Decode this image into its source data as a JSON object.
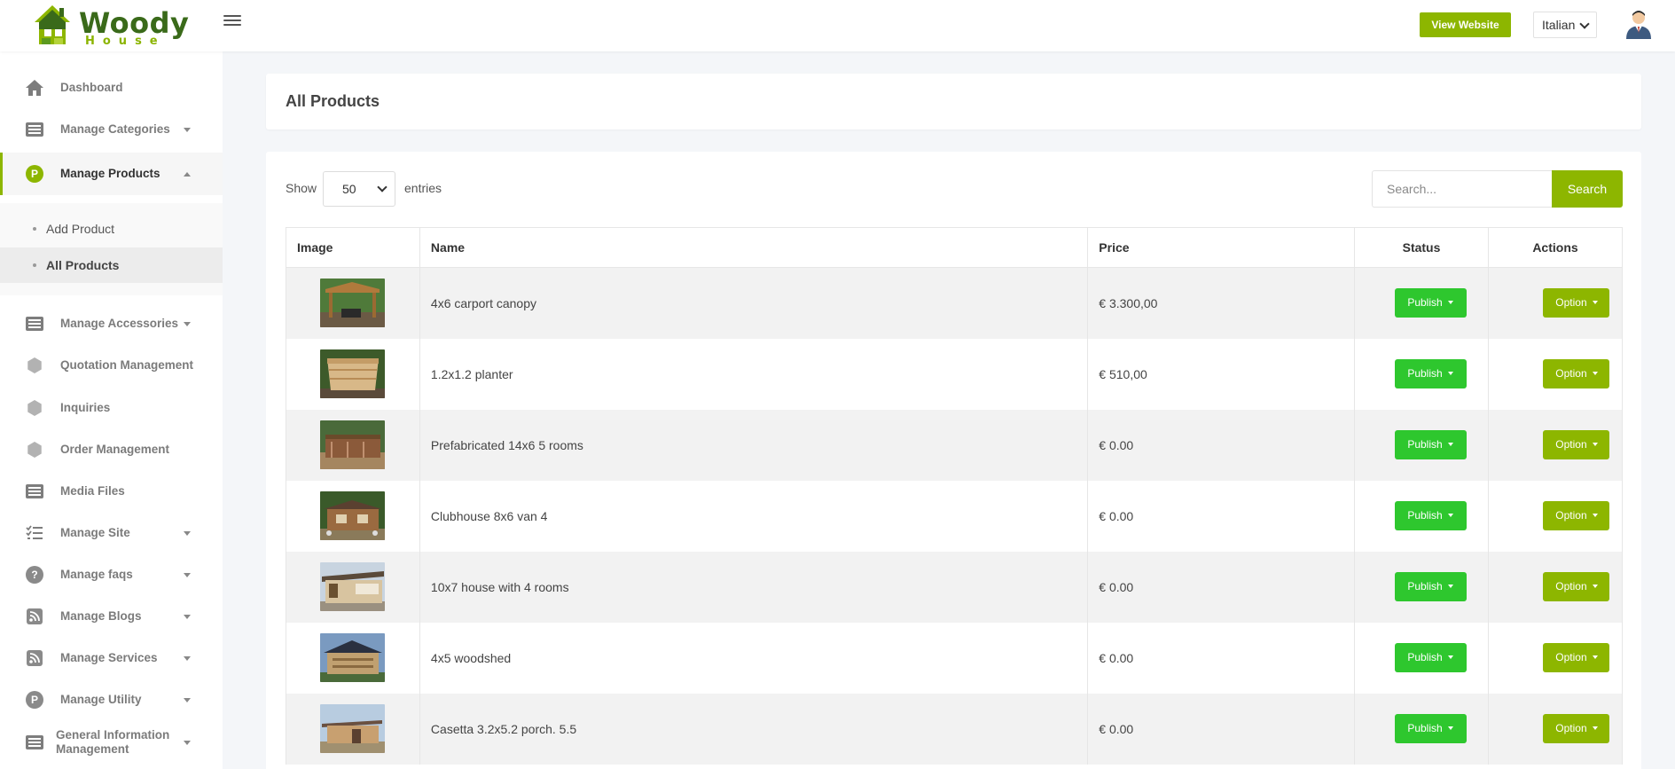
{
  "header": {
    "brand_line1": "Woody",
    "brand_line2": "House",
    "view_website": "View Website",
    "language": "Italian"
  },
  "sidebar": {
    "items": [
      {
        "label": "Dashboard",
        "icon": "home-icon"
      },
      {
        "label": "Manage Categories",
        "icon": "list-icon"
      },
      {
        "label": "Manage Products",
        "icon": "products-icon"
      },
      {
        "label": "Manage Accessories",
        "icon": "list-icon"
      },
      {
        "label": "Quotation Management",
        "icon": "hexagon-icon"
      },
      {
        "label": "Inquiries",
        "icon": "hexagon-icon"
      },
      {
        "label": "Order Management",
        "icon": "hexagon-icon"
      },
      {
        "label": "Media Files",
        "icon": "list-icon"
      },
      {
        "label": "Manage Site",
        "icon": "checklist-icon"
      },
      {
        "label": "Manage faqs",
        "icon": "question-icon"
      },
      {
        "label": "Manage Blogs",
        "icon": "rss-icon"
      },
      {
        "label": "Manage Services",
        "icon": "rss-icon"
      },
      {
        "label": "Manage Utility",
        "icon": "utility-icon"
      },
      {
        "label_line1": "General Information",
        "label_line2": "Management",
        "icon": "list-icon"
      }
    ],
    "sub_items": [
      {
        "label": "Add Product"
      },
      {
        "label": "All Products"
      }
    ],
    "product_icon_letter": "P",
    "faq_icon_letter": "?"
  },
  "main": {
    "title": "All Products",
    "show_label": "Show",
    "entries_value": "50",
    "entries_label": "entries",
    "search_placeholder": "Search...",
    "search_button": "Search",
    "columns": [
      "Image",
      "Name",
      "Price",
      "Status",
      "Actions"
    ],
    "rows": [
      {
        "name": "4x6 carport canopy",
        "price": "€ 3.300,00",
        "status": "Publish",
        "action": "Option"
      },
      {
        "name": "1.2x1.2 planter",
        "price": "€ 510,00",
        "status": "Publish",
        "action": "Option"
      },
      {
        "name": "Prefabricated 14x6 5 rooms",
        "price": "€ 0.00",
        "status": "Publish",
        "action": "Option"
      },
      {
        "name": "Clubhouse 8x6 van 4",
        "price": "€ 0.00",
        "status": "Publish",
        "action": "Option"
      },
      {
        "name": "10x7 house with 4 rooms",
        "price": "€ 0.00",
        "status": "Publish",
        "action": "Option"
      },
      {
        "name": "4x5 woodshed",
        "price": "€ 0.00",
        "status": "Publish",
        "action": "Option"
      },
      {
        "name": "Casetta 3.2x5.2 porch. 5.5",
        "price": "€ 0.00",
        "status": "Publish",
        "action": "Option"
      }
    ]
  },
  "colors": {
    "accent": "#8db600",
    "publish": "#2ec72e",
    "brand_dark": "#3a6a1a"
  }
}
